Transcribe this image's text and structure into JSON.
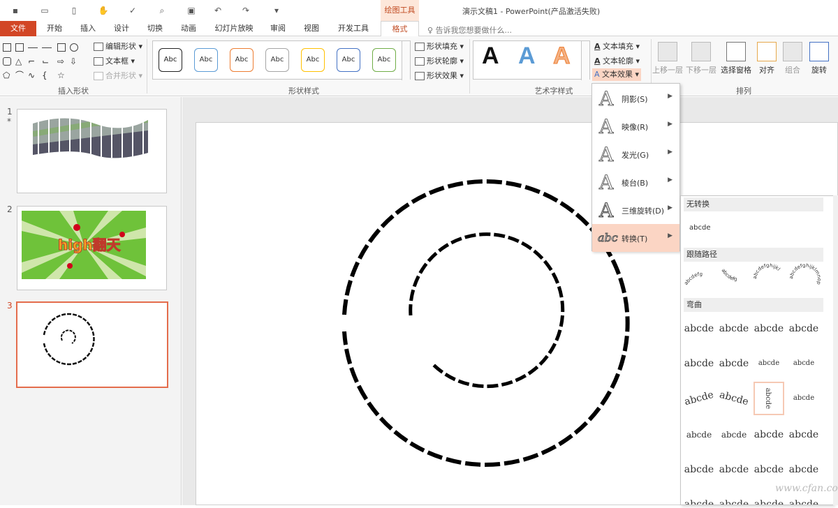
{
  "title_bar": {
    "context_label": "绘图工具",
    "doc_title": "演示文稿1 - PowerPoint(产品激活失败)"
  },
  "tabs": [
    "文件",
    "开始",
    "插入",
    "设计",
    "切换",
    "动画",
    "幻灯片放映",
    "审阅",
    "视图",
    "开发工具",
    "格式"
  ],
  "tell_me": "告诉我您想要做什么...",
  "ribbon": {
    "insert_shapes": {
      "label": "插入形状",
      "edit_shape": "编辑形状",
      "text_box": "文本框",
      "merge_shapes": "合并形状"
    },
    "shape_styles": {
      "label": "形状样式",
      "sample": "Abc",
      "fill": "形状填充",
      "outline": "形状轮廓",
      "effects": "形状效果"
    },
    "wordart": {
      "label": "艺术字样式",
      "letter": "A",
      "text_fill": "文本填充",
      "text_outline": "文本轮廓",
      "text_effects": "文本效果"
    },
    "arrange": {
      "label": "排列",
      "bring_forward": "上移一层",
      "send_backward": "下移一层",
      "selection_pane": "选择窗格",
      "align": "对齐",
      "group": "组合",
      "rotate": "旋转"
    }
  },
  "slides": [
    {
      "number": "1",
      "star": "*"
    },
    {
      "number": "2",
      "promo_text": "high翻天"
    },
    {
      "number": "3"
    }
  ],
  "text_effects_menu": [
    {
      "label": "阴影(S)"
    },
    {
      "label": "映像(R)"
    },
    {
      "label": "发光(G)"
    },
    {
      "label": "棱台(B)"
    },
    {
      "label": "三维旋转(D)"
    },
    {
      "label": "转换(T)",
      "icon_text": "abc"
    }
  ],
  "transform_panel": {
    "no_transform_title": "无转换",
    "no_transform_sample": "abcde",
    "follow_path_title": "跟随路径",
    "follow_path_samples": [
      "abcdefg",
      "abcdefg",
      "abcdefghijkl",
      "abcdefghijklmnop"
    ],
    "warp_title": "弯曲",
    "warp_sample": "abcde"
  },
  "watermark": "www.cfan.com.cn"
}
